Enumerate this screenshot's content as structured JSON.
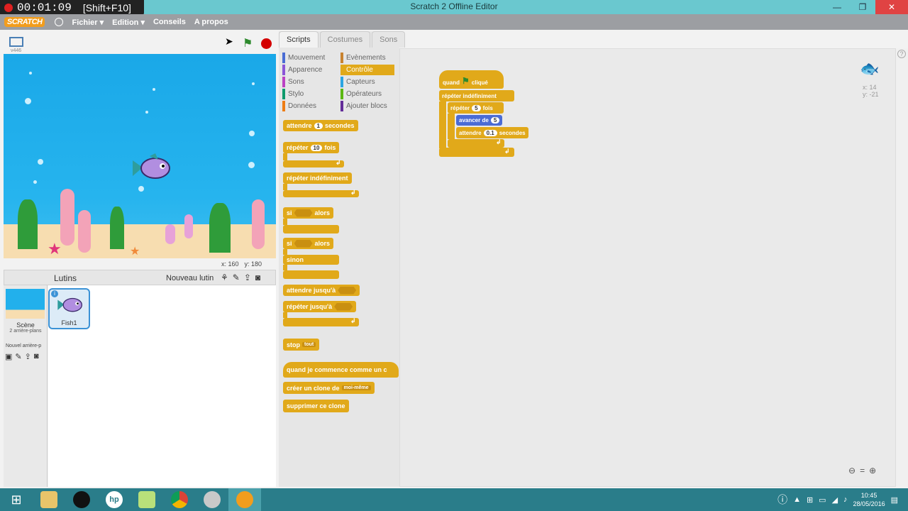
{
  "window": {
    "title": "Scratch 2 Offline Editor",
    "recorder_time": "00:01:09",
    "recorder_hotkey": "[Shift+F10]"
  },
  "menubar": {
    "logo": "SCRATCH",
    "items": [
      "Fichier ▾",
      "Edition ▾",
      "Conseils",
      "A propos"
    ]
  },
  "stage": {
    "version": "v446",
    "mouse_x_label": "x: 160",
    "mouse_y_label": "y: 180"
  },
  "sprites": {
    "header": "Lutins",
    "new_sprite": "Nouveau lutin",
    "scene_label": "Scène",
    "scene_sub": "2 arrière-plans",
    "new_backdrop": "Nouvel arrière-p",
    "sprite_name": "Fish1"
  },
  "tabs": [
    "Scripts",
    "Costumes",
    "Sons"
  ],
  "categories": {
    "left": [
      {
        "label": "Mouvement",
        "color": "#4a6cd4"
      },
      {
        "label": "Apparence",
        "color": "#8a55d7"
      },
      {
        "label": "Sons",
        "color": "#bb42c3"
      },
      {
        "label": "Stylo",
        "color": "#0e9a6c"
      },
      {
        "label": "Données",
        "color": "#ee7d16"
      }
    ],
    "right": [
      {
        "label": "Evènements",
        "color": "#c88330"
      },
      {
        "label": "Contrôle",
        "color": "#e1a91a"
      },
      {
        "label": "Capteurs",
        "color": "#2ca5e2"
      },
      {
        "label": "Opérateurs",
        "color": "#5cb712"
      },
      {
        "label": "Ajouter blocs",
        "color": "#632d99"
      }
    ]
  },
  "palette": {
    "wait": "attendre",
    "wait_val": "1",
    "wait_unit": "secondes",
    "repeat": "répéter",
    "repeat_val": "10",
    "repeat_unit": "fois",
    "forever": "répéter indéfiniment",
    "if": "si",
    "then": "alors",
    "else": "sinon",
    "wait_until": "attendre jusqu'à",
    "repeat_until": "répéter jusqu'à",
    "stop": "stop",
    "stop_val": "tout",
    "clone_start": "quand je commence comme un c",
    "create_clone": "créer un clone de",
    "clone_target": "moi-même",
    "delete_clone": "supprimer ce clone"
  },
  "script": {
    "hat_when": "quand",
    "hat_clicked": "cliqué",
    "forever": "répéter indéfiniment",
    "repeat": "répéter",
    "repeat_val": "5",
    "repeat_unit": "fois",
    "move": "avancer de",
    "move_val": "5",
    "wait": "attendre",
    "wait_val": "0.1",
    "wait_unit": "secondes"
  },
  "sprite_info": {
    "x": "x: 14",
    "y": "y: -21"
  },
  "taskbar": {
    "time": "10:45",
    "date": "28/05/2016"
  }
}
